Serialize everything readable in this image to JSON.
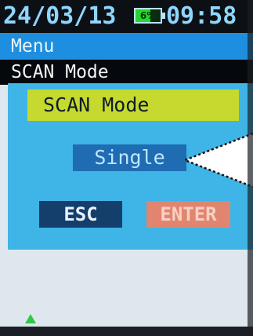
{
  "status_bar": {
    "date": "24/03/13",
    "battery": {
      "label": "6%",
      "level_percent": 6
    },
    "time": "09:58"
  },
  "menu": {
    "title": "Menu"
  },
  "submenu": {
    "title": "SCAN Mode"
  },
  "dialog": {
    "title": "SCAN Mode",
    "selected_value": "Single",
    "buttons": {
      "esc": "ESC",
      "enter": "ENTER"
    }
  },
  "colors": {
    "menu_bar": "#1e8fe0",
    "dialog_bg": "#3fb4e6",
    "dialog_title_bg": "#c6d92e",
    "value_bg": "#1f6cb3",
    "esc_bg": "#143f6c",
    "enter_bg": "#e2856f",
    "indicator": "#2cc84a"
  },
  "icons": {
    "battery": "battery-icon",
    "indicator": "triangle-indicator-icon",
    "pointer": "callout-pointer"
  }
}
